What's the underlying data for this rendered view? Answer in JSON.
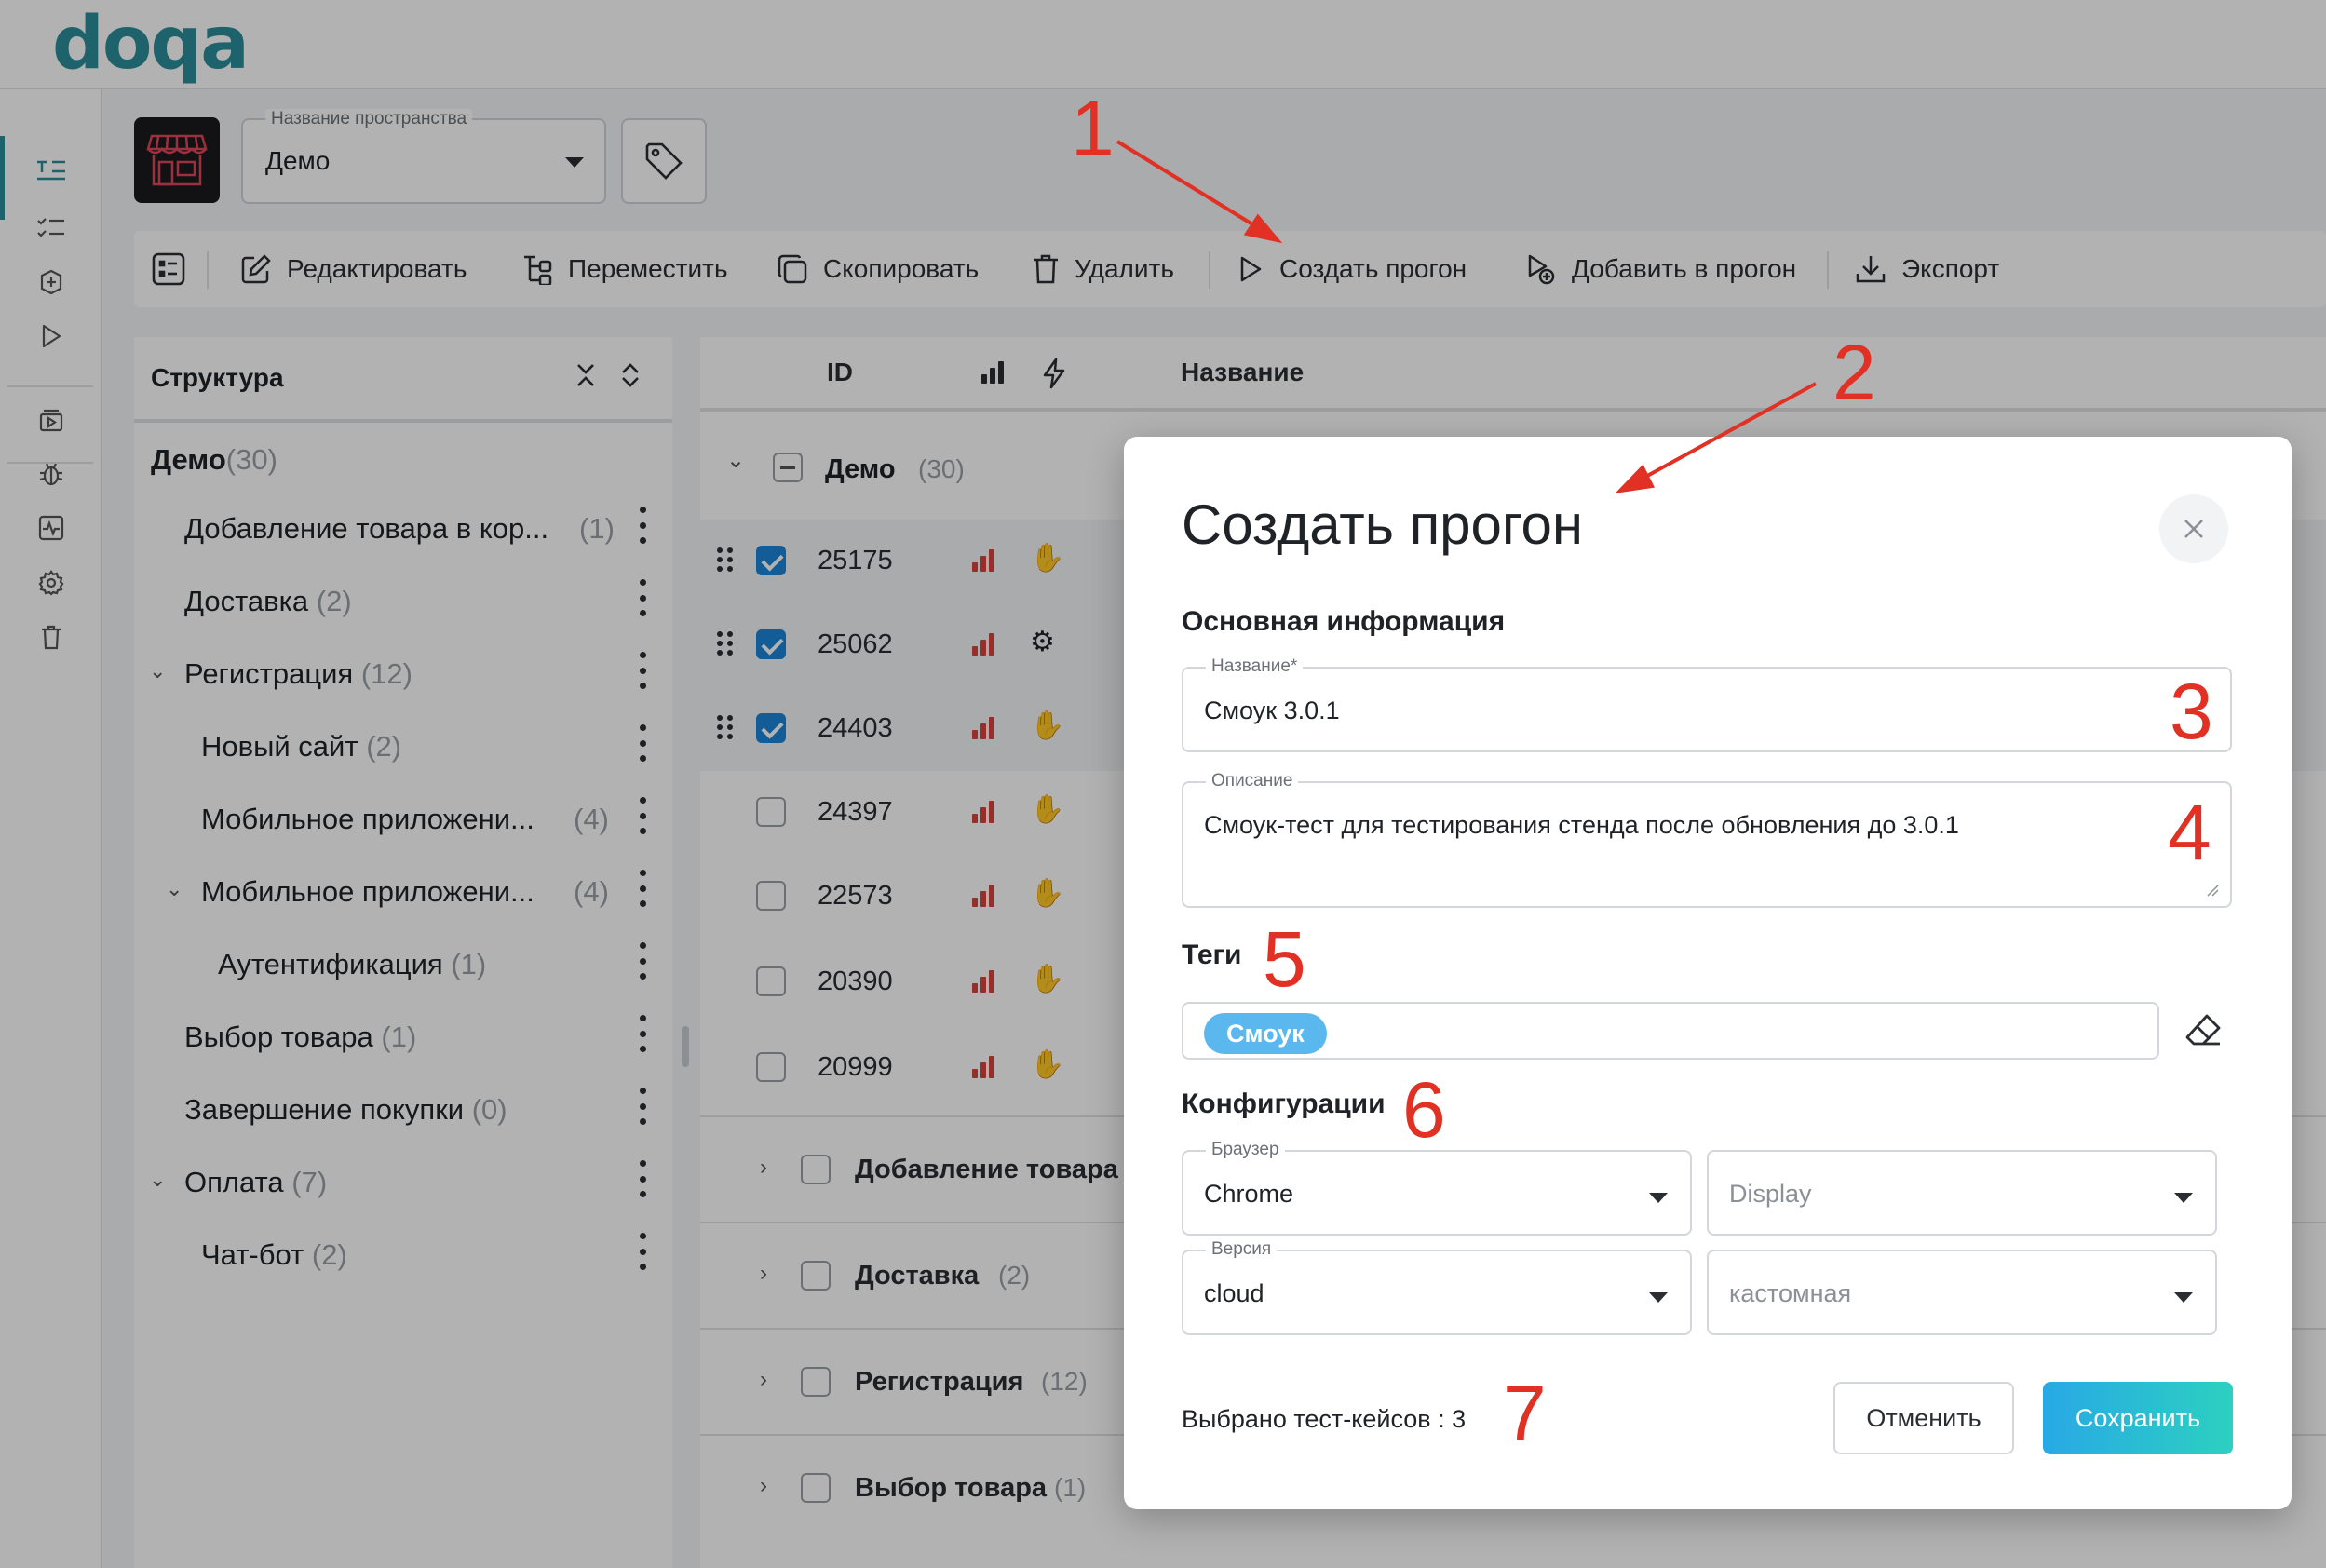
{
  "app": {
    "logo": "doqa"
  },
  "space": {
    "label": "Название пространства",
    "value": "Демо"
  },
  "toolbar": {
    "edit": "Редактировать",
    "move": "Переместить",
    "copy": "Скопировать",
    "delete": "Удалить",
    "create_run": "Создать прогон",
    "add_to_run": "Добавить в прогон",
    "export": "Экспорт"
  },
  "structure": {
    "title": "Структура",
    "root": {
      "label": "Демо",
      "count": "(30)"
    },
    "items": [
      {
        "label": "Добавление товара в кор...",
        "count": "(1)"
      },
      {
        "label": "Доставка",
        "count": "(2)"
      },
      {
        "label": "Регистрация",
        "count": "(12)"
      },
      {
        "label": "Новый сайт",
        "count": "(2)"
      },
      {
        "label": "Мобильное приложени...",
        "count": "(4)"
      },
      {
        "label": "Мобильное приложени...",
        "count": "(4)"
      },
      {
        "label": "Аутентификация",
        "count": "(1)"
      },
      {
        "label": "Выбор товара",
        "count": "(1)"
      },
      {
        "label": "Завершение покупки",
        "count": "(0)"
      },
      {
        "label": "Оплата",
        "count": "(7)"
      },
      {
        "label": "Чат-бот",
        "count": "(2)"
      }
    ]
  },
  "table": {
    "headers": {
      "id": "ID",
      "name": "Название"
    },
    "group": {
      "name": "Демо",
      "count": "(30)"
    },
    "rows": [
      {
        "id": "25175",
        "checked": true
      },
      {
        "id": "25062",
        "checked": true
      },
      {
        "id": "24403",
        "checked": true
      },
      {
        "id": "24397",
        "checked": false
      },
      {
        "id": "22573",
        "checked": false
      },
      {
        "id": "20390",
        "checked": false
      },
      {
        "id": "20999",
        "checked": false
      }
    ],
    "groups": [
      {
        "name": "Добавление товара в",
        "count": ""
      },
      {
        "name": "Доставка",
        "count": "(2)"
      },
      {
        "name": "Регистрация",
        "count": "(12)"
      },
      {
        "name": "Выбор товара",
        "count": "(1)"
      }
    ]
  },
  "modal": {
    "title": "Создать прогон",
    "section_main": "Основная информация",
    "name_label": "Название*",
    "name_value": "Смоук 3.0.1",
    "desc_label": "Описание",
    "desc_value": "Смоук-тест для тестирования стенда после обновления до 3.0.1",
    "tags_title": "Теги",
    "tag": "Смоук",
    "config_title": "Конфигурации",
    "browser_label": "Браузер",
    "browser_value": "Chrome",
    "display_placeholder": "Display",
    "version_label": "Версия",
    "version_value": "cloud",
    "custom_placeholder": "кастомная",
    "selected_count": "Выбрано тест-кейсов : 3",
    "cancel": "Отменить",
    "save": "Сохранить"
  },
  "annotations": [
    "1",
    "2",
    "3",
    "4",
    "5",
    "6",
    "7"
  ],
  "colors": {
    "accent": "#2b8d9b",
    "annotation": "#e03124",
    "checkbox": "#1a84d8",
    "tag": "#5ab8ef"
  }
}
